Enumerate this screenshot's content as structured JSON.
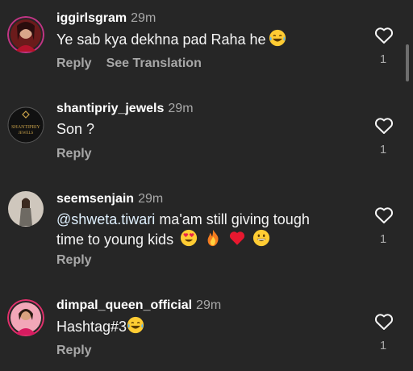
{
  "comments": [
    {
      "username": "iggirlsgram",
      "time": "29m",
      "text": "Ye sab kya dekhna pad Raha he",
      "reply_label": "Reply",
      "translation_label": "See Translation",
      "like_count": "1",
      "emojis": [
        "face-with-tears-of-joy"
      ]
    },
    {
      "username": "shantipriy_jewels",
      "time": "29m",
      "text": "Son ?",
      "reply_label": "Reply",
      "like_count": "1",
      "avatar_logo_line1": "SHANTIPRIY",
      "avatar_logo_line2": "JEWELS"
    },
    {
      "username": "seemsenjain",
      "time": "29m",
      "mention": "@shweta.tiwari",
      "text_line1": " ma'am still giving tough",
      "text_line2": "time to young kids",
      "reply_label": "Reply",
      "like_count": "1",
      "emojis": [
        "heart-eyes",
        "fire",
        "red-heart",
        "grinning-face"
      ]
    },
    {
      "username": "dimpal_queen_official",
      "time": "29m",
      "text": "Hashtag#3",
      "reply_label": "Reply",
      "like_count": "1",
      "emojis": [
        "face-with-tears-of-joy"
      ]
    }
  ],
  "colors": {
    "background": "#262626",
    "username": "#ffffff",
    "secondary": "#a8a8a8",
    "mention": "#e0f1ff"
  }
}
